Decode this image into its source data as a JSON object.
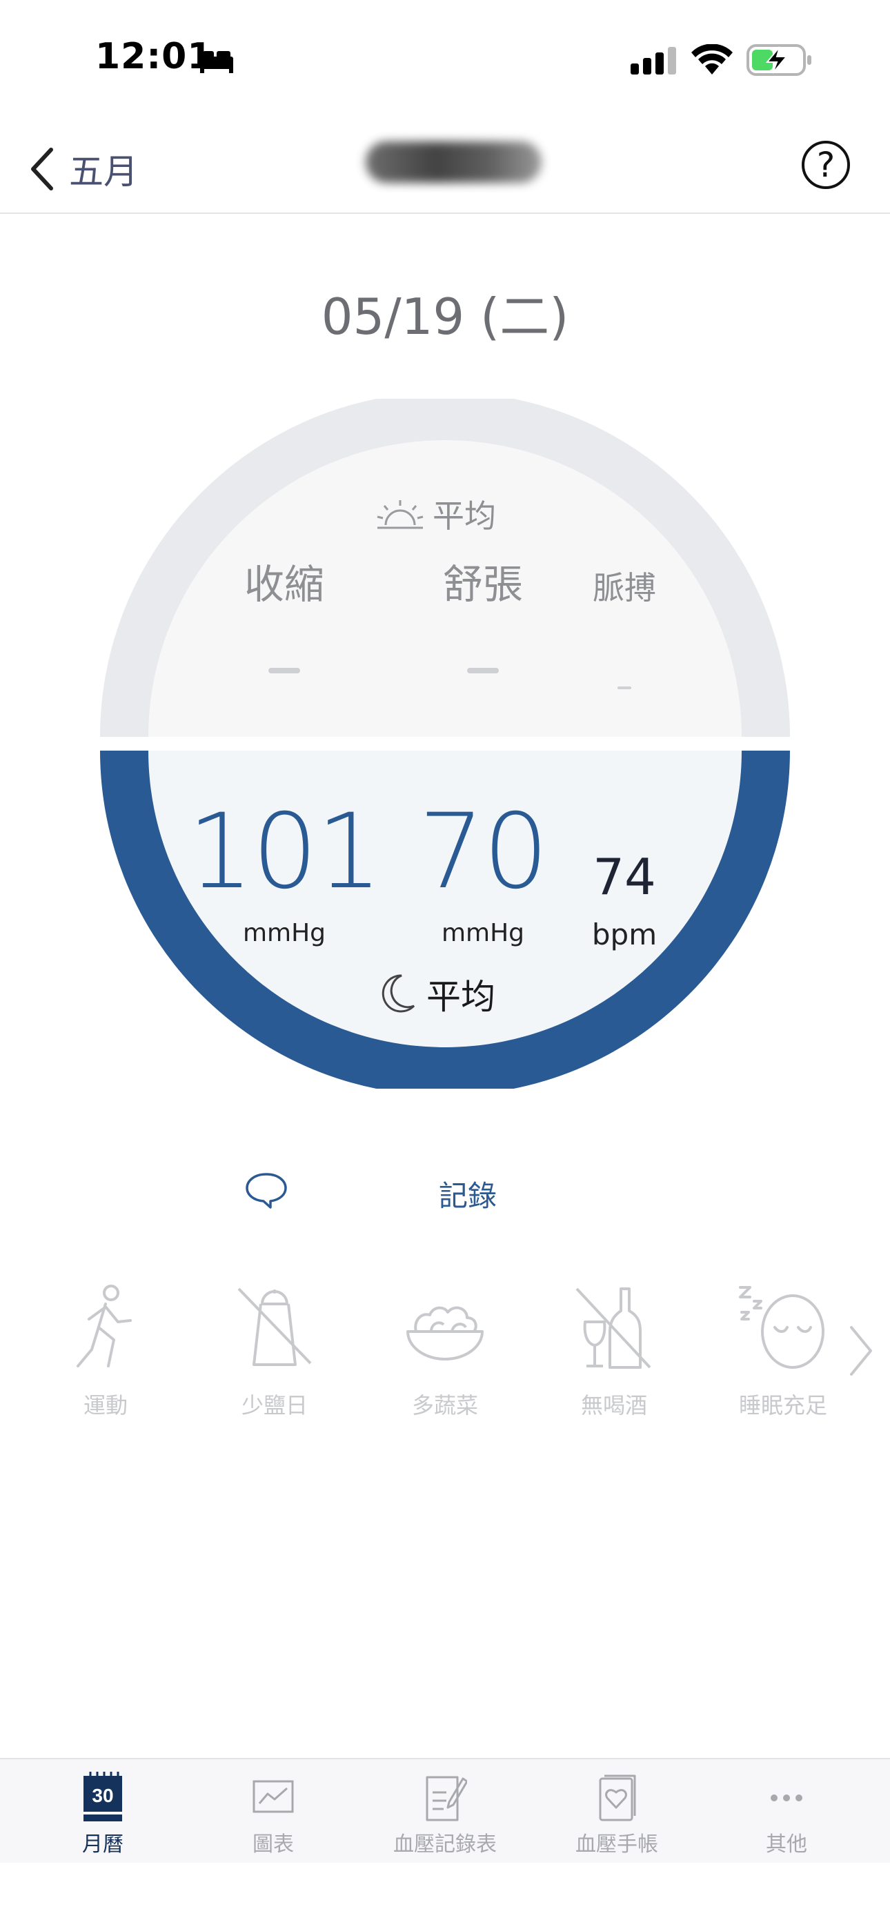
{
  "status_bar": {
    "time": "12:01"
  },
  "nav": {
    "back_label": "五月",
    "help_symbol": "?"
  },
  "date": "05/19 (二)",
  "gauge": {
    "morning_label": "平均",
    "evening_label": "平均",
    "columns": {
      "systolic": "收縮",
      "diastolic": "舒張",
      "pulse": "脈搏"
    },
    "evening": {
      "systolic": "101",
      "systolic_unit": "mmHg",
      "diastolic": "70",
      "diastolic_unit": "mmHg",
      "pulse": "74",
      "pulse_unit": "bpm"
    },
    "colors": {
      "morning_ring": "#e9eaed",
      "evening_ring": "#295a94",
      "morning_fill": "#f7f7f7",
      "evening_fill": "#f2f6f9"
    }
  },
  "record": {
    "label": "記錄"
  },
  "habits": [
    {
      "label": "運動",
      "icon": "running-icon"
    },
    {
      "label": "少鹽日",
      "icon": "no-salt-icon"
    },
    {
      "label": "多蔬菜",
      "icon": "salad-bowl-icon"
    },
    {
      "label": "無喝酒",
      "icon": "no-alcohol-icon"
    },
    {
      "label": "睡眠充足",
      "icon": "sleep-icon"
    }
  ],
  "tabs": [
    {
      "label": "月曆",
      "badge": "30",
      "active": true
    },
    {
      "label": "圖表"
    },
    {
      "label": "血壓記錄表"
    },
    {
      "label": "血壓手帳"
    },
    {
      "label": "其他"
    }
  ]
}
